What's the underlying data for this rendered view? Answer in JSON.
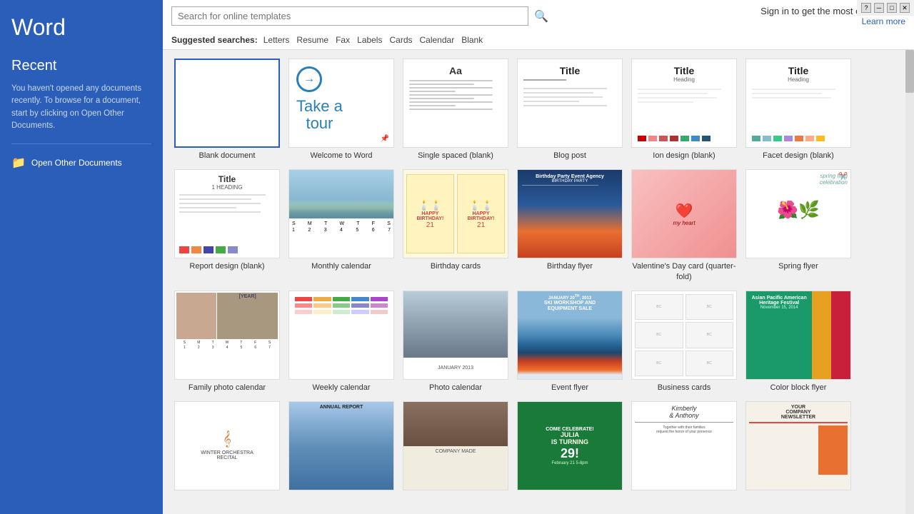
{
  "app": {
    "title": "Word"
  },
  "sidebar": {
    "recent_label": "Recent",
    "empty_message": "You haven't opened any documents recently. To browse for a document, start by clicking on Open Other Documents.",
    "open_other_label": "Open Other Documents"
  },
  "topbar": {
    "search_placeholder": "Search for online templates",
    "sign_in_text": "Sign in to get the most out of Office",
    "learn_more": "Learn more",
    "filter_label": "Suggested searches:",
    "filters": [
      "Letters",
      "Resume",
      "Fax",
      "Labels",
      "Cards",
      "Calendar",
      "Blank"
    ]
  },
  "templates": [
    {
      "id": "blank",
      "label": "Blank document",
      "type": "blank",
      "selected": true
    },
    {
      "id": "tour",
      "label": "Welcome to Word",
      "type": "tour",
      "pin": true
    },
    {
      "id": "single-spaced",
      "label": "Single spaced (blank)",
      "type": "single-spaced"
    },
    {
      "id": "blog-post",
      "label": "Blog post",
      "type": "blog-post"
    },
    {
      "id": "ion-design",
      "label": "Ion design (blank)",
      "type": "ion-design"
    },
    {
      "id": "facet-design",
      "label": "Facet design (blank)",
      "type": "facet-design"
    },
    {
      "id": "report-design",
      "label": "Report design (blank)",
      "type": "report-design"
    },
    {
      "id": "monthly-cal",
      "label": "Monthly calendar",
      "type": "monthly-cal"
    },
    {
      "id": "birthday-cards",
      "label": "Birthday cards",
      "type": "birthday-cards"
    },
    {
      "id": "birthday-flyer",
      "label": "Birthday flyer",
      "type": "birthday-flyer"
    },
    {
      "id": "valentines-card",
      "label": "Valentine's Day card (quarter-fold)",
      "type": "valentines-card"
    },
    {
      "id": "spring-flyer",
      "label": "Spring flyer",
      "type": "spring-flyer"
    },
    {
      "id": "family-photo-cal",
      "label": "Family photo calendar",
      "type": "family-photo-cal"
    },
    {
      "id": "weekly-cal",
      "label": "Weekly calendar",
      "type": "weekly-cal"
    },
    {
      "id": "photo-cal",
      "label": "Photo calendar",
      "type": "photo-cal"
    },
    {
      "id": "event-flyer",
      "label": "Event flyer",
      "type": "event-flyer"
    },
    {
      "id": "business-cards",
      "label": "Business cards",
      "type": "business-cards"
    },
    {
      "id": "color-block-flyer",
      "label": "Color block flyer",
      "type": "color-block-flyer"
    },
    {
      "id": "row4-1",
      "label": "",
      "type": "row4-1"
    },
    {
      "id": "row4-2",
      "label": "",
      "type": "row4-2"
    },
    {
      "id": "row4-3",
      "label": "",
      "type": "row4-3"
    },
    {
      "id": "row4-4",
      "label": "",
      "type": "row4-4"
    },
    {
      "id": "row4-5",
      "label": "",
      "type": "row4-5"
    },
    {
      "id": "row4-6",
      "label": "",
      "type": "row4-6"
    }
  ],
  "colors": {
    "sidebar_bg": "#2b5eb8",
    "accent": "#2b5eb8"
  }
}
